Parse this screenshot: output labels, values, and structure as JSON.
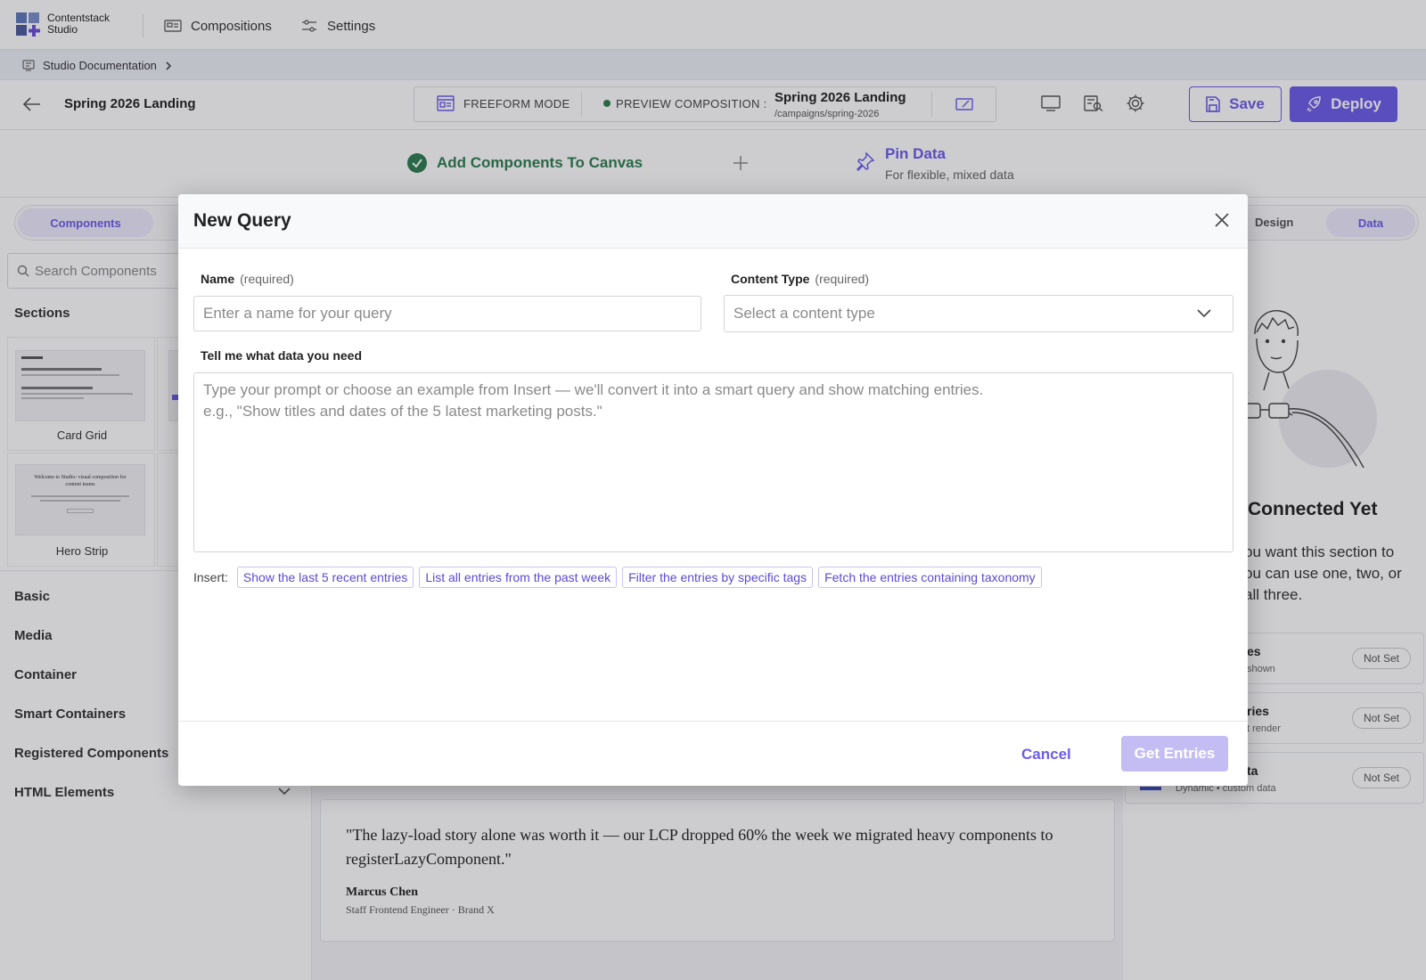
{
  "app": {
    "name": "Contentstack",
    "subname": "Studio"
  },
  "nav": {
    "compositions": "Compositions",
    "settings": "Settings"
  },
  "breadcrumb": {
    "label": "Studio Documentation"
  },
  "toolbar": {
    "page_title": "Spring 2026 Landing",
    "freeform_mode": "FREEFORM MODE",
    "preview_label": "PREVIEW COMPOSITION :",
    "preview_name": "Spring 2026 Landing",
    "preview_path": "/campaigns/spring-2026",
    "save": "Save",
    "deploy": "Deploy"
  },
  "steps": {
    "add_components": "Add Components To Canvas",
    "pin_data": "Pin Data",
    "pin_data_sub": "For flexible, mixed data"
  },
  "left_panel": {
    "tab_components": "Components",
    "search_placeholder": "Search Components",
    "sections_heading": "Sections",
    "thumbs": [
      {
        "label": "Card Grid"
      },
      {
        "label": "Hero Strip"
      }
    ],
    "hero_thumb_text": "Welcome to Studio: visual composition for content teams",
    "categories": [
      "Basic",
      "Media",
      "Container",
      "Smart Containers",
      "Registered Components",
      "HTML Elements"
    ]
  },
  "right_panel": {
    "tab_design": "Design",
    "tab_data": "Data",
    "empty_title": "Connected Yet",
    "empty_desc_1": "ou want this section to",
    "empty_desc_2": "ou can use one, two, or",
    "empty_desc_3": "all three.",
    "slots": [
      {
        "title": "es",
        "sub": "shown",
        "status": "Not Set"
      },
      {
        "title": "ries",
        "sub": "t render",
        "status": "Not Set"
      },
      {
        "title": "ta",
        "sub": "Dynamic • custom data",
        "status": "Not Set"
      }
    ]
  },
  "canvas": {
    "quote": "\"The lazy-load story alone was worth it — our LCP dropped 60% the week we migrated heavy components to registerLazyComponent.\"",
    "author": "Marcus Chen",
    "author_role": "Staff Frontend Engineer · Brand X"
  },
  "modal": {
    "title": "New Query",
    "name_label": "Name",
    "name_req": "(required)",
    "name_placeholder": "Enter a name for your query",
    "ct_label": "Content Type",
    "ct_req": "(required)",
    "ct_placeholder": "Select a content type",
    "prompt_label": "Tell me what data you need",
    "prompt_placeholder": "Type your prompt or choose an example from Insert — we'll convert it into a smart query and show matching entries.\ne.g., \"Show titles and dates of the 5 latest marketing posts.\"",
    "insert_label": "Insert:",
    "insert_chips": [
      "Show the last 5 recent entries",
      "List all entries from the past week",
      "Filter the entries by specific tags",
      "Fetch the entries containing taxonomy"
    ],
    "cancel": "Cancel",
    "get_entries": "Get Entries"
  },
  "colors": {
    "accent": "#6c5ce7",
    "success": "#2e7d4f",
    "get_entries_disabled": "#c4bdf3"
  }
}
